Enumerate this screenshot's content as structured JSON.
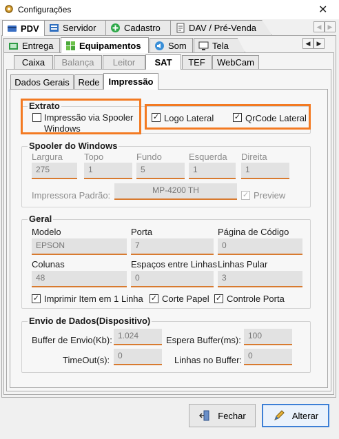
{
  "window": {
    "title": "Configurações"
  },
  "top_tabs": [
    {
      "label": "PDV",
      "icon": "card-icon"
    },
    {
      "label": "Servidor",
      "icon": "servidor-icon"
    },
    {
      "label": "Cadastro",
      "icon": "plus-icon"
    },
    {
      "label": "DAV / Pré-Venda",
      "icon": "document-icon"
    }
  ],
  "second_tabs": [
    {
      "label": "Entrega",
      "icon": "entrega-icon"
    },
    {
      "label": "Equipamentos",
      "icon": "equipamentos-icon"
    },
    {
      "label": "Som",
      "icon": "speaker-icon"
    },
    {
      "label": "Tela",
      "icon": "screen-icon"
    }
  ],
  "third_tabs": [
    "Caixa",
    "Balança",
    "Leitor",
    "SAT",
    "TEF",
    "WebCam"
  ],
  "fourth_tabs": [
    "Dados Gerais",
    "Rede",
    "Impressão"
  ],
  "extrato": {
    "title": "Extrato",
    "spooler_label_line1": "Impressão via Spooler",
    "spooler_label_line2": "Windows",
    "spooler_checked": false,
    "logo_label": "Logo Lateral",
    "logo_checked": true,
    "qrcode_label": "QrCode Lateral",
    "qrcode_checked": true
  },
  "spooler": {
    "title": "Spooler do Windows",
    "largura_label": "Largura",
    "largura_value": "275",
    "topo_label": "Topo",
    "topo_value": "1",
    "fundo_label": "Fundo",
    "fundo_value": "5",
    "esquerda_label": "Esquerda",
    "esquerda_value": "1",
    "direita_label": "Direita",
    "direita_value": "1",
    "impressora_label": "Impressora Padrão:",
    "impressora_value": "MP-4200 TH",
    "preview_label": "Preview",
    "preview_checked": true
  },
  "geral": {
    "title": "Geral",
    "modelo_label": "Modelo",
    "modelo_value": "EPSON",
    "porta_label": "Porta",
    "porta_value": "7",
    "pagina_label": "Página de Código",
    "pagina_value": "0",
    "colunas_label": "Colunas",
    "colunas_value": "48",
    "espacos_label": "Espaços entre Linhas",
    "espacos_value": "0",
    "linhas_label": "Linhas Pular",
    "linhas_value": "3",
    "imprimir_label": "Imprimir Item em 1 Linha",
    "imprimir_checked": true,
    "corte_label": "Corte Papel",
    "corte_checked": true,
    "controle_label": "Controle Porta",
    "controle_checked": true
  },
  "envio": {
    "title": "Envio de Dados(Dispositivo)",
    "buffer_label": "Buffer de Envio(Kb):",
    "buffer_value": "1.024",
    "espera_label": "Espera Buffer(ms):",
    "espera_value": "100",
    "timeout_label": "TimeOut(s):",
    "timeout_value": "0",
    "linhas_buffer_label": "Linhas no Buffer:",
    "linhas_buffer_value": "0"
  },
  "buttons": {
    "fechar": "Fechar",
    "alterar": "Alterar"
  },
  "colors": {
    "highlight": "#f37a22",
    "field_underline": "#d87a2f",
    "primary_button": "#3c7fd6"
  }
}
